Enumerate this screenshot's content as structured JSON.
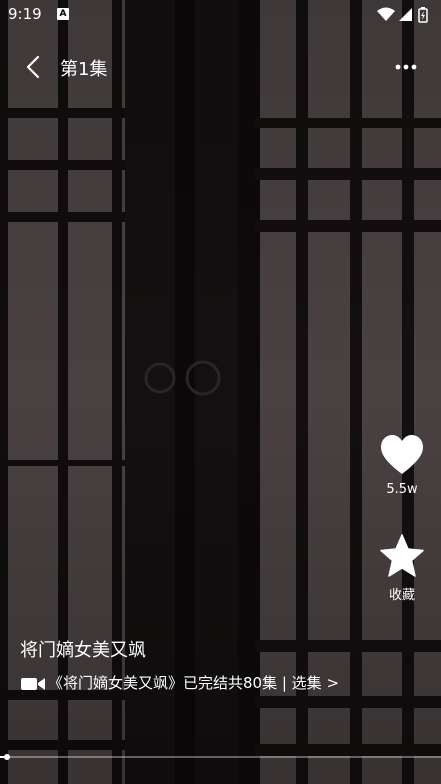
{
  "status_bar": {
    "time": "9:19",
    "app_icon": "A",
    "icons": [
      "wifi-icon",
      "signal-icon",
      "battery-icon"
    ]
  },
  "header": {
    "episode_title": "第1集",
    "back_icon": "chevron-left-icon",
    "more_icon": "more-dots-icon"
  },
  "actions": {
    "like_count": "5.5w",
    "favorite_label": "收藏"
  },
  "drama": {
    "title": "将门嫡女美又飒",
    "info_line": "《将门嫡女美又飒》已完结共80集 | 选集 >"
  },
  "playback": {
    "progress_fraction": 0.01
  },
  "colors": {
    "text": "#ffffff",
    "background": "#48403f"
  }
}
